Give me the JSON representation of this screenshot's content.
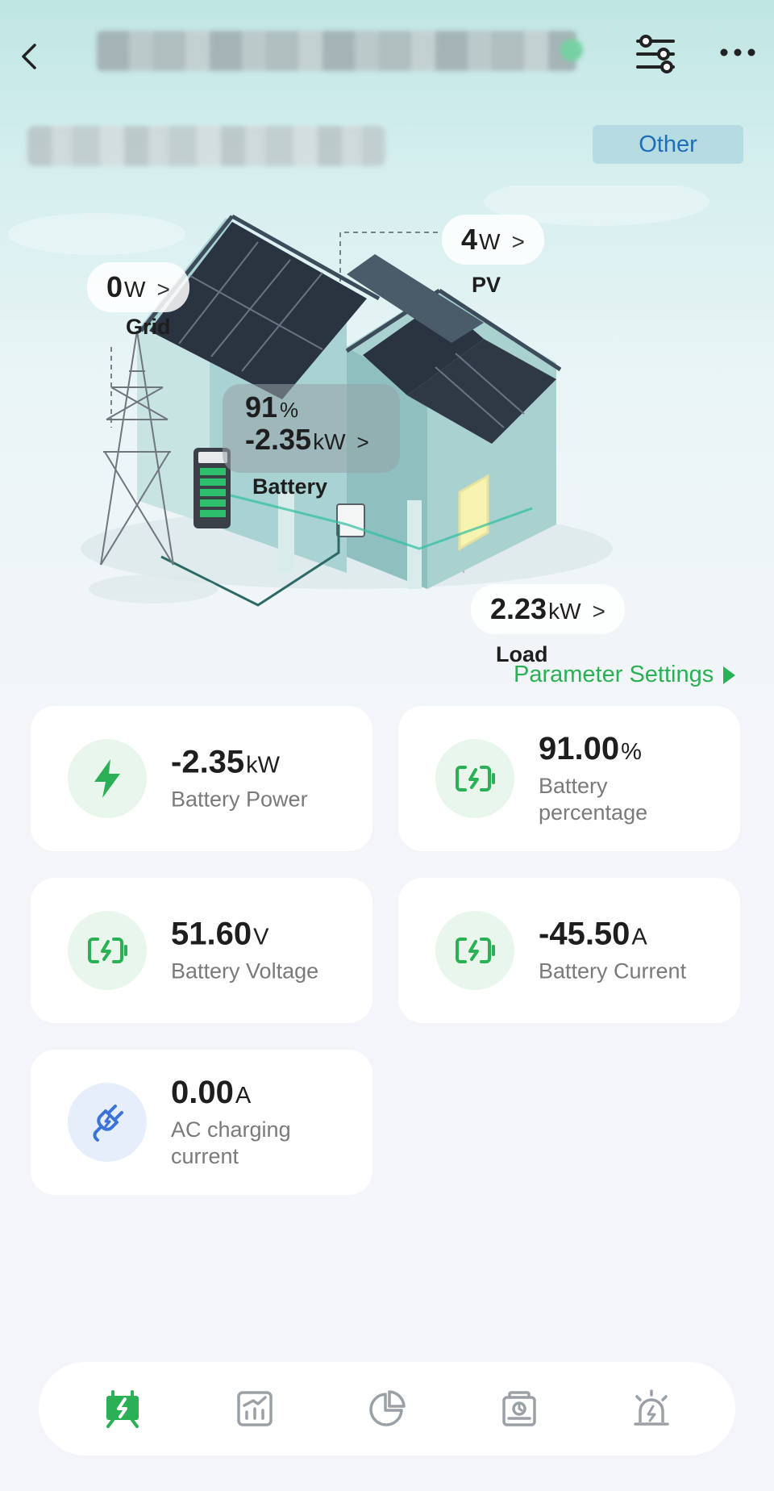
{
  "header": {
    "back_icon": "chevron-left-icon",
    "filter_icon": "sliders-icon",
    "more_icon": "more-horizontal-icon",
    "mode_chip": "Other"
  },
  "flow": {
    "grid": {
      "value": "0",
      "unit": "W",
      "label": "Grid"
    },
    "pv": {
      "value": "4",
      "unit": "W",
      "label": "PV"
    },
    "battery": {
      "percent": "91",
      "percent_unit": "%",
      "value": "-2.35",
      "unit": "kW",
      "label": "Battery"
    },
    "load": {
      "value": "2.23",
      "unit": "kW",
      "label": "Load"
    },
    "chevron": ">"
  },
  "parameter_settings": "Parameter Settings",
  "metrics": [
    {
      "value": "-2.35",
      "unit": "kW",
      "label": "Battery Power",
      "icon": "lightning-icon"
    },
    {
      "value": "91.00",
      "unit": "%",
      "label": "Battery percentage",
      "icon": "battery-charging-icon"
    },
    {
      "value": "51.60",
      "unit": "V",
      "label": "Battery Voltage",
      "icon": "battery-charging-icon"
    },
    {
      "value": "-45.50",
      "unit": "A",
      "label": "Battery Current",
      "icon": "battery-charging-icon"
    },
    {
      "value": "0.00",
      "unit": "A",
      "label": "AC charging current",
      "icon": "plug-icon"
    }
  ],
  "nav": [
    {
      "icon": "energy-flow-icon",
      "active": true
    },
    {
      "icon": "statistics-chart-icon",
      "active": false
    },
    {
      "icon": "pie-chart-icon",
      "active": false
    },
    {
      "icon": "device-icon",
      "active": false
    },
    {
      "icon": "alarm-icon",
      "active": false
    }
  ],
  "colors": {
    "accent": "#2bb055",
    "chip_text": "#1f6fb8",
    "chip_bg": "#b6dbe3",
    "inactive_icon": "#9aa0a6"
  }
}
